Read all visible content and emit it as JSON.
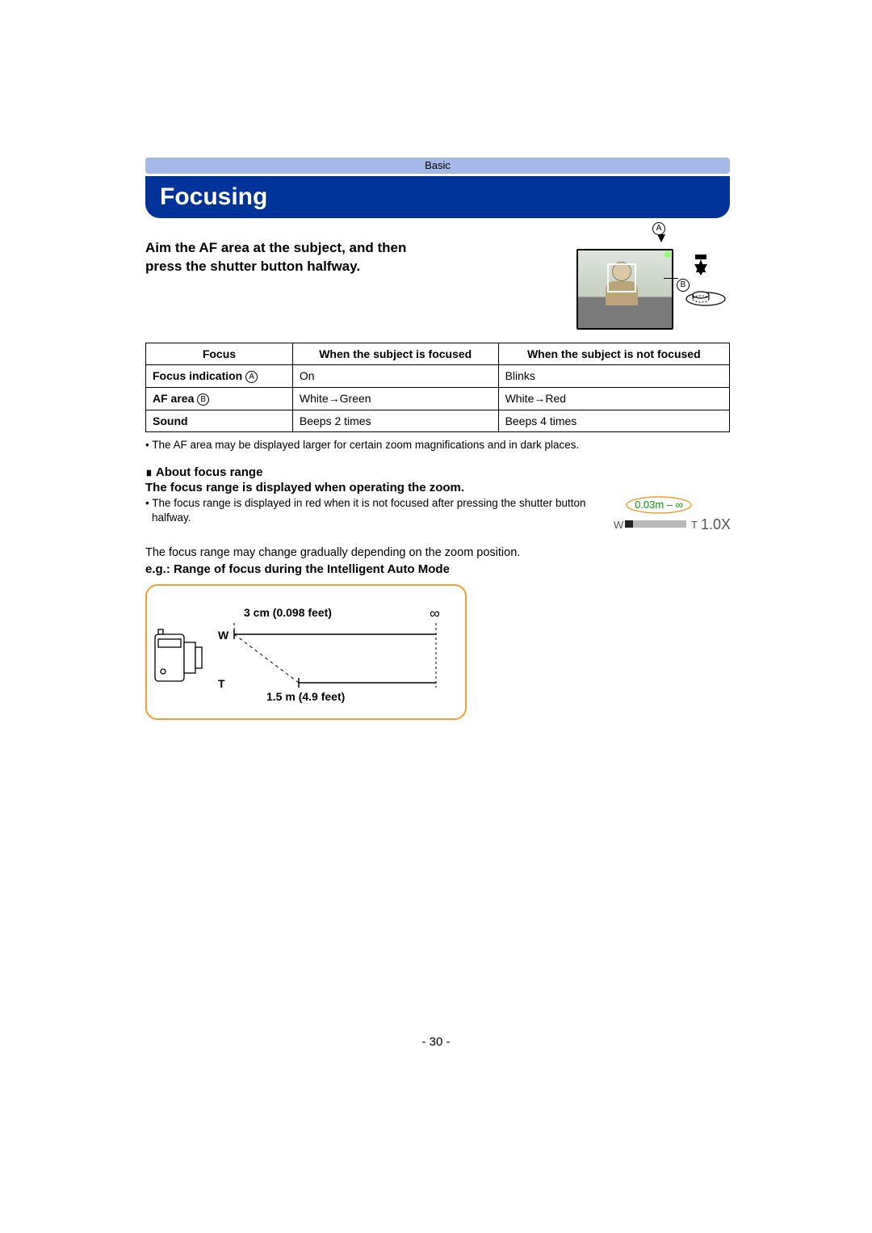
{
  "header": {
    "category": "Basic"
  },
  "title": "Focusing",
  "intro": "Aim the AF area at the subject, and then press the shutter button halfway.",
  "labels": {
    "a": "A",
    "b": "B"
  },
  "table": {
    "headers": [
      "Focus",
      "When the subject is focused",
      "When the subject is not focused"
    ],
    "rows": [
      {
        "label": "Focus indication",
        "marker": "A",
        "focused": "On",
        "unfocused": "Blinks"
      },
      {
        "label": "AF area",
        "marker": "B",
        "focused": "White→Green",
        "unfocused": "White→Red"
      },
      {
        "label": "Sound",
        "marker": "",
        "focused": "Beeps 2 times",
        "unfocused": "Beeps 4 times"
      }
    ]
  },
  "note_af_area": "The AF area may be displayed larger for certain zoom magnifications and in dark places.",
  "about_head": "About focus range",
  "about_sub": "The focus range is displayed when operating the zoom.",
  "about_red": "The focus range is displayed in red when it is not focused after pressing the shutter button halfway.",
  "zoom_indicator": {
    "range": "0.03m – ∞",
    "w": "W",
    "t": "T",
    "zoom": "1.0X"
  },
  "gradual": "The focus range may change gradually depending on the zoom position.",
  "eg": "e.g.: Range of focus during the Intelligent Auto Mode",
  "range_diagram": {
    "w": "W",
    "t": "T",
    "top_label": "3 cm (0.098 feet)",
    "bottom_label": "1.5 m (4.9 feet)",
    "infinity": "∞"
  },
  "page_number": "- 30 -"
}
